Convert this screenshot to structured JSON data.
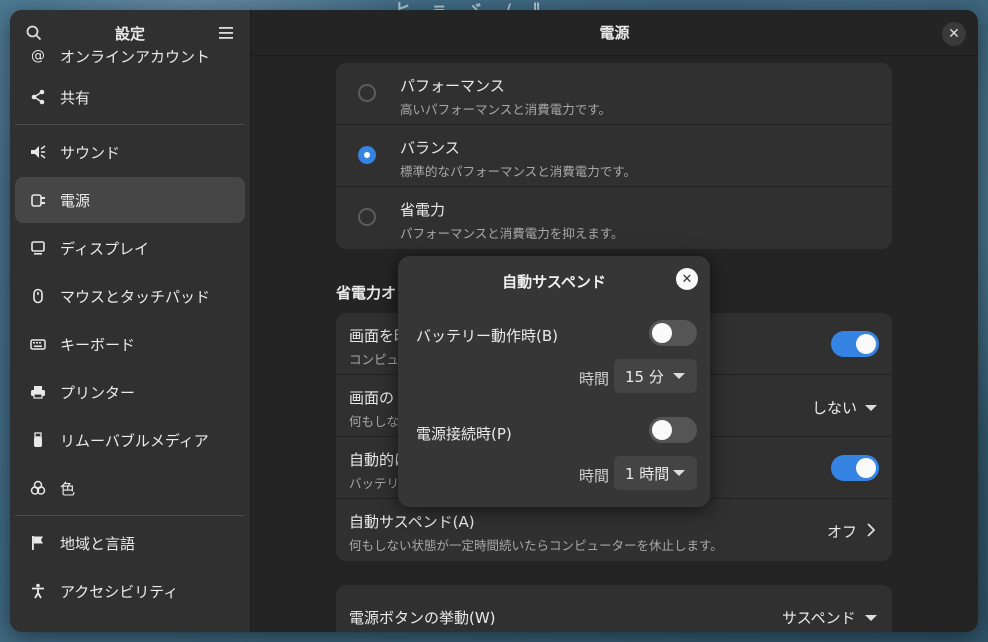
{
  "sidebar": {
    "title": "設定",
    "items": [
      {
        "label": "オンラインアカウント",
        "icon": "at-icon"
      },
      {
        "label": "共有",
        "icon": "share-icon"
      },
      {
        "label": "サウンド",
        "icon": "speaker-icon"
      },
      {
        "label": "電源",
        "icon": "power-plug-icon"
      },
      {
        "label": "ディスプレイ",
        "icon": "display-icon"
      },
      {
        "label": "マウスとタッチパッド",
        "icon": "mouse-icon"
      },
      {
        "label": "キーボード",
        "icon": "keyboard-icon"
      },
      {
        "label": "プリンター",
        "icon": "printer-icon"
      },
      {
        "label": "リムーバブルメディア",
        "icon": "usb-icon"
      },
      {
        "label": "色",
        "icon": "color-icon"
      },
      {
        "label": "地域と言語",
        "icon": "flag-icon"
      },
      {
        "label": "アクセシビリティ",
        "icon": "accessibility-icon"
      }
    ]
  },
  "main": {
    "title": "電源",
    "power_modes": [
      {
        "title": "パフォーマンス",
        "subtitle": "高いパフォーマンスと消費電力です。",
        "selected": false
      },
      {
        "title": "バランス",
        "subtitle": "標準的なパフォーマンスと消費電力です。",
        "selected": true
      },
      {
        "title": "省電力",
        "subtitle": "パフォーマンスと消費電力を抑えます。",
        "selected": false
      }
    ],
    "saving_section_title": "省電力オ",
    "saving_rows": {
      "dim_title": "画面を暗",
      "dim_sub": "コンピュ",
      "blank_title": "画面の",
      "blank_sub": "何もしな",
      "blank_value": "しない",
      "auto_title": "自動的に",
      "auto_sub": "バッテリ",
      "suspend_title": "自動サスペンド(A)",
      "suspend_sub": "何もしない状態が一定時間続いたらコンピューターを休止します。",
      "suspend_value": "オフ"
    },
    "power_button": {
      "title": "電源ボタンの挙動(W)",
      "value": "サスペンド"
    }
  },
  "dialog": {
    "title": "自動サスペンド",
    "battery_label": "バッテリー動作時(B)",
    "battery_on": false,
    "battery_time_label": "時間",
    "battery_time_value": "15 分",
    "plugged_label": "電源接続時(P)",
    "plugged_on": false,
    "plugged_time_label": "時間",
    "plugged_time_value": "1 時間"
  },
  "colors": {
    "accent": "#3584e4",
    "window_bg": "#242424",
    "sidebar_bg": "#303030",
    "card_bg": "#303030",
    "dialog_bg": "#363636"
  }
}
